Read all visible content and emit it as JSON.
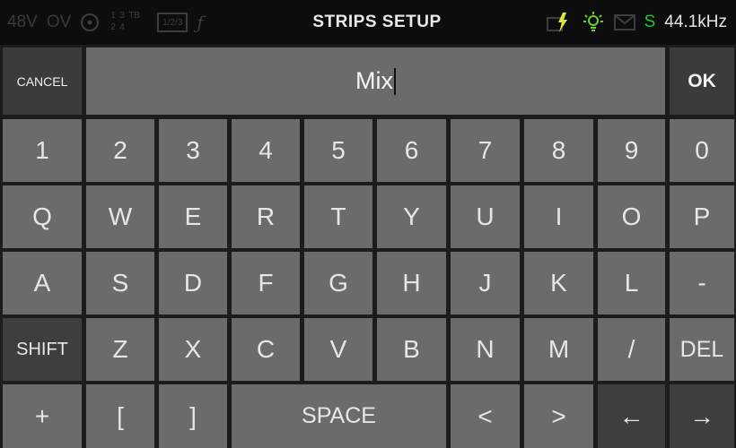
{
  "status": {
    "left": {
      "phantom_label": "48V",
      "overload_label": "OV",
      "bus_digits": [
        "1",
        "2",
        "3",
        "4"
      ],
      "bus_tb_label": "TB",
      "routing_label": "1/2/3"
    },
    "title": "STRIPS SETUP",
    "right": {
      "s_label": "S",
      "sample_rate": "44.1kHz"
    },
    "colors": {
      "lightning": "#e2e63a",
      "bulb": "#6cd02c",
      "sync": "#22c33a"
    }
  },
  "name_row": {
    "cancel_label": "CANCEL",
    "name_value": "Mix",
    "ok_label": "OK"
  },
  "keyboard": {
    "row1": [
      "1",
      "2",
      "3",
      "4",
      "5",
      "6",
      "7",
      "8",
      "9",
      "0"
    ],
    "row2": [
      "Q",
      "W",
      "E",
      "R",
      "T",
      "Y",
      "U",
      "I",
      "O",
      "P"
    ],
    "row3": [
      "A",
      "S",
      "D",
      "F",
      "G",
      "H",
      "J",
      "K",
      "L",
      "-"
    ],
    "row4": [
      "SHIFT",
      "Z",
      "X",
      "C",
      "V",
      "B",
      "N",
      "M",
      "/",
      "DEL"
    ],
    "row5": {
      "plus": "+",
      "bracket_open": "[",
      "bracket_close": "]",
      "space": "SPACE",
      "less": "<",
      "greater": ">",
      "left_arrow": "←",
      "right_arrow": "→"
    }
  }
}
